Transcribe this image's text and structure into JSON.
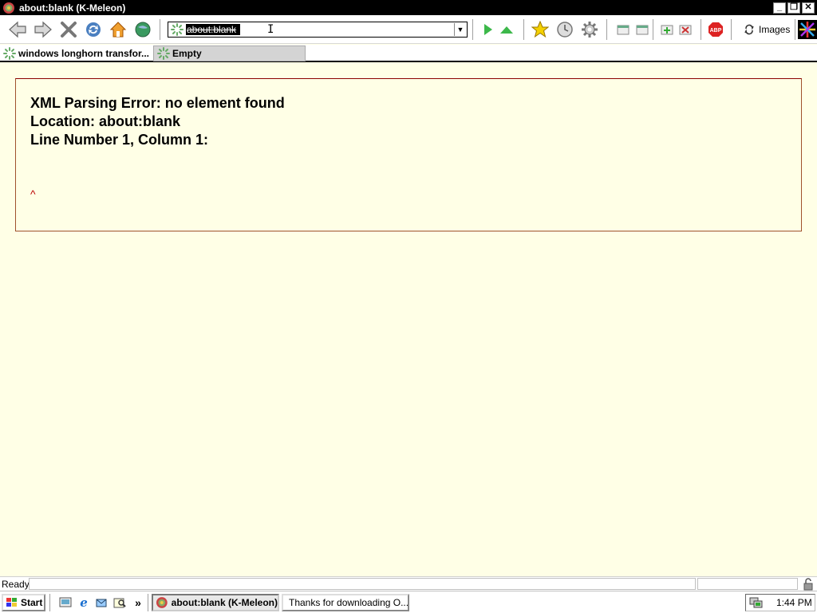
{
  "window": {
    "title": "about:blank (K-Meleon)",
    "controls": {
      "minimize": "_",
      "restore": "❐",
      "close": "✕"
    }
  },
  "toolbar": {
    "address_value": "about:blank",
    "images_label": "Images",
    "icons": [
      "back-icon",
      "forward-icon",
      "stop-icon",
      "reload-icon",
      "home-icon",
      "globe-icon",
      "go-icon",
      "up-icon",
      "bookmark-star-icon",
      "history-icon",
      "settings-gear-icon",
      "layer-prev-icon",
      "layer-next-icon",
      "new-layer-icon",
      "close-layer-icon",
      "adblock-icon",
      "images-icon",
      "kmeleon-logo-icon"
    ]
  },
  "tabs": [
    {
      "label": "windows longhorn transfor...",
      "active": false
    },
    {
      "label": "Empty",
      "active": true
    }
  ],
  "page": {
    "error_title": "XML Parsing Error: no element found",
    "error_location": "Location: about:blank",
    "error_line": "Line Number 1, Column 1:",
    "error_caret": "^"
  },
  "status": {
    "text": "Ready"
  },
  "taskbar": {
    "start_label": "Start",
    "overflow": "»",
    "tasks": [
      {
        "label": "about:blank (K-Meleon)",
        "active": true
      },
      {
        "label": "Thanks for downloading O...",
        "active": false
      }
    ],
    "clock": "1:44 PM"
  },
  "colors": {
    "page_background": "#ffffe6",
    "error_border": "#a0522d",
    "caret": "#bb0000",
    "titlebar": "#000000"
  }
}
